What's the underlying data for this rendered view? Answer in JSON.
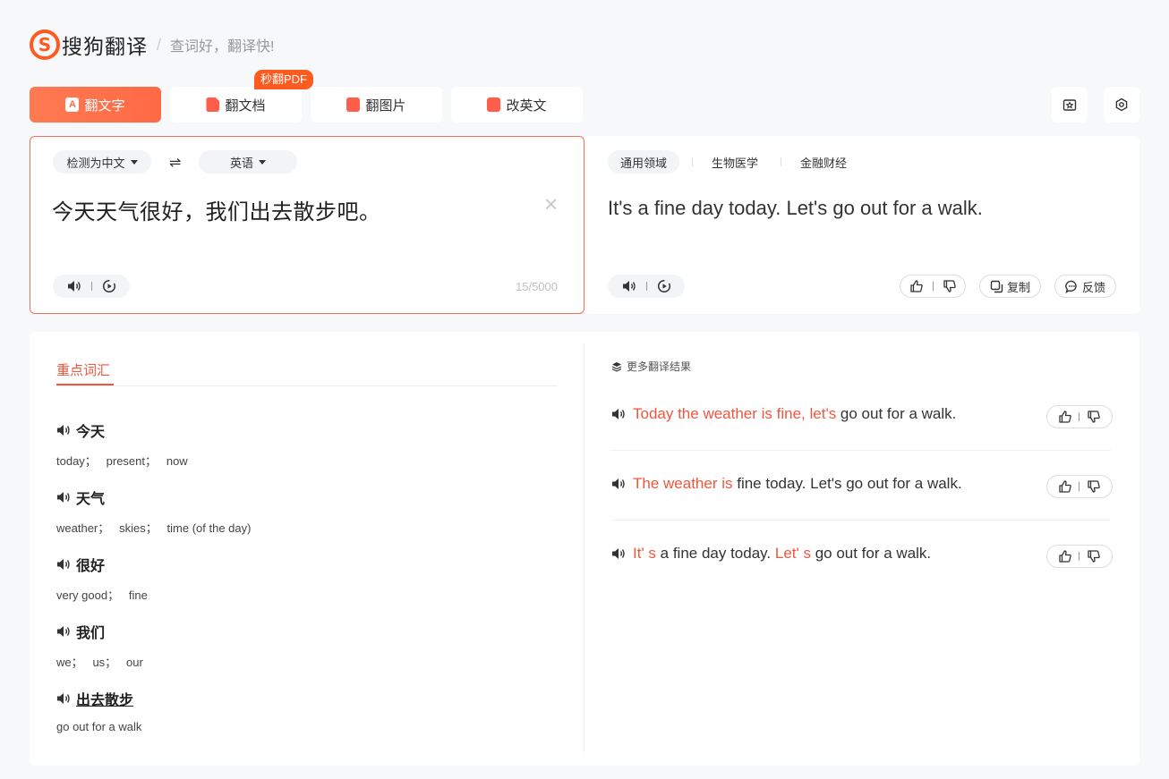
{
  "app": {
    "name": "搜狗翻译",
    "slogan": "查词好，翻译快!",
    "logo_letter": "S"
  },
  "tabs": [
    {
      "label": "翻文字",
      "icon": "text-icon",
      "active": true
    },
    {
      "label": "翻文档",
      "icon": "document-icon"
    },
    {
      "label": "翻图片",
      "icon": "image-icon"
    },
    {
      "label": "改英文",
      "icon": "edit-icon"
    }
  ],
  "pdf_badge": "秒翻PDF",
  "source": {
    "lang": "检测为中文",
    "target_lang": "英语",
    "swap_symbol": "⇌",
    "text": "今天天气很好，我们出去散步吧。",
    "count": "15/5000"
  },
  "target": {
    "domains": [
      "通用领域",
      "生物医学",
      "金融财经"
    ],
    "text": "It's a fine day today. Let's go out for a walk.",
    "copy_label": "复制",
    "feedback_label": "反馈"
  },
  "vocab": {
    "tab_label": "重点词汇",
    "words": [
      {
        "word": "今天",
        "defs": "today；   present；   now"
      },
      {
        "word": "天气",
        "defs": "weather；   skies；   time (of the day)"
      },
      {
        "word": "很好",
        "defs": "very good；   fine"
      },
      {
        "word": "我们",
        "defs": "we；   us；   our"
      },
      {
        "word": "出去散步",
        "defs": "go out for a walk"
      }
    ]
  },
  "more": {
    "title": "更多翻译结果",
    "results": [
      {
        "hl": "Today the weather is fine, let's",
        "rest": " go out for a walk."
      },
      {
        "hl": "The weather is",
        "rest": " fine today. Let's go out for a walk."
      },
      {
        "hl": "It' s",
        "mid": " a fine day today. ",
        "hl2": "Let' s",
        "rest": " go out for a walk."
      }
    ]
  },
  "colors": {
    "accent": "#f0563d",
    "brand": "#ff5a1f"
  }
}
